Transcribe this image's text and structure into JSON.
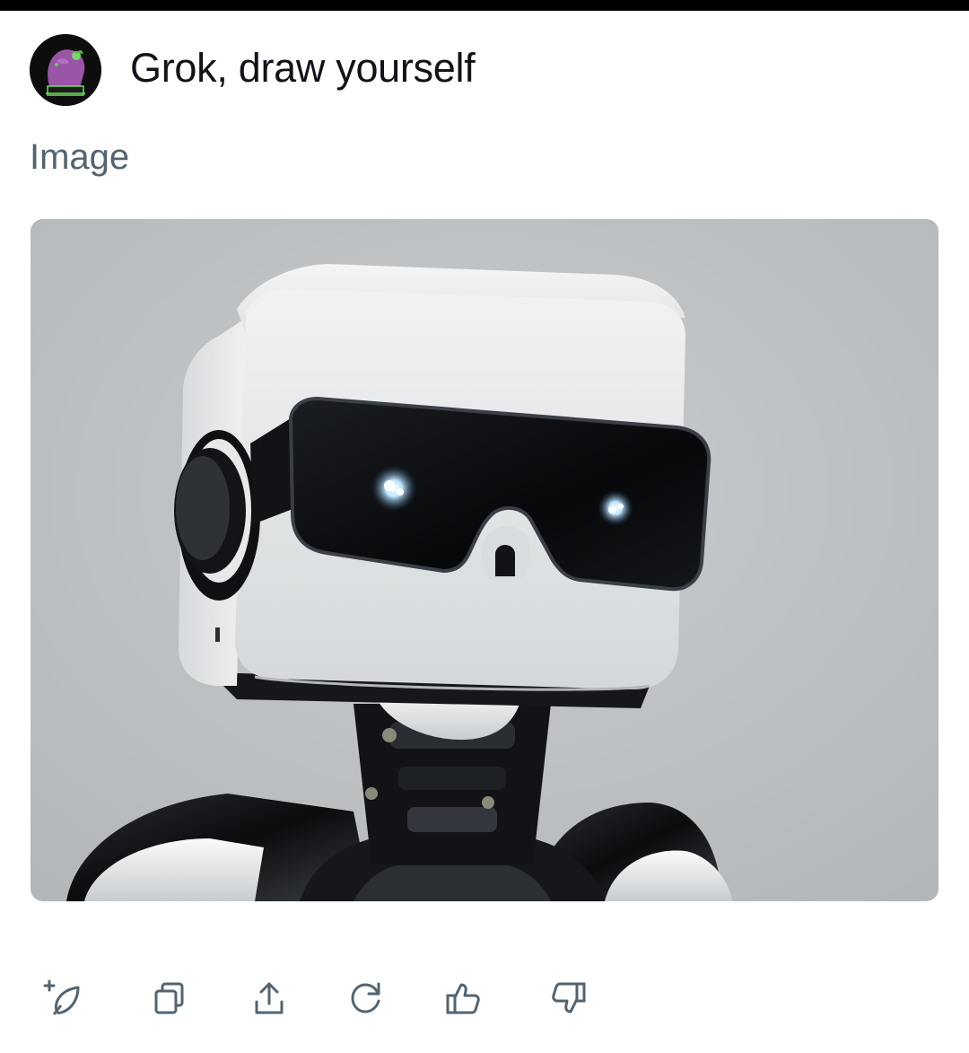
{
  "prompt": {
    "text": "Grok, draw yourself"
  },
  "result": {
    "label": "Image",
    "image_subject": "white cube-headed robot wearing black visor glasses"
  },
  "actions": [
    {
      "name": "regenerate-new-icon",
      "icon": "plus-leaf"
    },
    {
      "name": "copy-icon",
      "icon": "copy"
    },
    {
      "name": "share-icon",
      "icon": "share-upload"
    },
    {
      "name": "refresh-icon",
      "icon": "refresh"
    },
    {
      "name": "thumbs-up-icon",
      "icon": "thumbs-up"
    },
    {
      "name": "thumbs-down-icon",
      "icon": "thumbs-down"
    }
  ],
  "colors": {
    "text_primary": "#0f1419",
    "text_secondary": "#536471",
    "icon": "#536471"
  }
}
